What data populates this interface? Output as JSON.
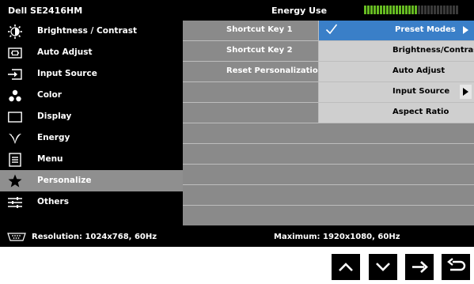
{
  "title_bar": {
    "model": "Dell SE2416HM",
    "energy_label": "Energy Use",
    "energy_level": 0.55,
    "meter_on_color": "#66bb22",
    "meter_off_color": "#3a3a3a"
  },
  "menu": [
    {
      "label": "Brightness / Contrast",
      "icon": "brightness-icon"
    },
    {
      "label": "Auto Adjust",
      "icon": "auto-adjust-icon"
    },
    {
      "label": "Input Source",
      "icon": "input-source-icon"
    },
    {
      "label": "Color",
      "icon": "color-icon"
    },
    {
      "label": "Display",
      "icon": "display-icon"
    },
    {
      "label": "Energy",
      "icon": "energy-icon"
    },
    {
      "label": "Menu",
      "icon": "menu-icon"
    },
    {
      "label": "Personalize",
      "icon": "star-icon",
      "active": true
    },
    {
      "label": "Others",
      "icon": "others-icon"
    }
  ],
  "personalize": {
    "items": [
      "Shortcut Key 1",
      "Shortcut Key 2",
      "Reset Personalization"
    ]
  },
  "shortcut_options": [
    {
      "label": "Preset Modes",
      "selected": true,
      "has_submenu": true
    },
    {
      "label": "Brightness/Contrast",
      "selected": false
    },
    {
      "label": "Auto Adjust",
      "selected": false
    },
    {
      "label": "Input Source",
      "selected": false,
      "has_submenu": true
    },
    {
      "label": "Aspect Ratio",
      "selected": false
    }
  ],
  "status_bar": {
    "resolution": "Resolution: 1024x768, 60Hz",
    "maximum": "Maximum: 1920x1080, 60Hz"
  },
  "nav_buttons": [
    {
      "name": "up",
      "icon": "up-arrow-icon"
    },
    {
      "name": "down",
      "icon": "down-arrow-icon"
    },
    {
      "name": "right",
      "icon": "right-arrow-icon"
    },
    {
      "name": "back",
      "icon": "back-icon"
    }
  ],
  "colors": {
    "accent": "#3a7fc8",
    "row_gray": "#8a8a8a",
    "row_light": "#cfcfcf"
  }
}
